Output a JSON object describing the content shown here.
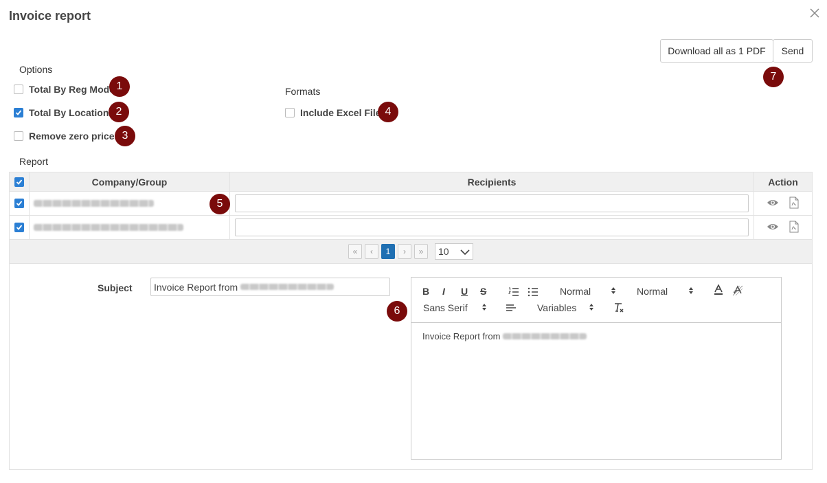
{
  "header": {
    "title": "Invoice report"
  },
  "actions": {
    "download_label": "Download all as 1 PDF",
    "send_label": "Send"
  },
  "options": {
    "heading": "Options",
    "items": [
      {
        "label": "Total By Reg Mode",
        "checked": false
      },
      {
        "label": "Total By Location",
        "checked": true
      },
      {
        "label": "Remove zero prices",
        "checked": false
      }
    ]
  },
  "formats": {
    "heading": "Formats",
    "items": [
      {
        "label": "Include Excel File",
        "checked": false
      }
    ]
  },
  "report": {
    "heading": "Report",
    "columns": [
      "Company/Group",
      "Recipients",
      "Action"
    ],
    "rows": [
      {
        "checked": true,
        "recipients": ""
      },
      {
        "checked": true,
        "recipients": ""
      }
    ],
    "pagination": {
      "current_page": "1",
      "page_size": "10"
    }
  },
  "email": {
    "subject_label": "Subject",
    "subject_value": "Invoice Report from",
    "body_text": "Invoice Report from",
    "toolbar": {
      "size1": "Normal",
      "size2": "Normal",
      "font": "Sans Serif",
      "variables": "Variables"
    }
  },
  "badges": [
    "1",
    "2",
    "3",
    "4",
    "5",
    "6",
    "7"
  ],
  "colors": {
    "badge": "#7a0b0b",
    "accent": "#2b7fd4",
    "page_active": "#1f6fb2"
  }
}
